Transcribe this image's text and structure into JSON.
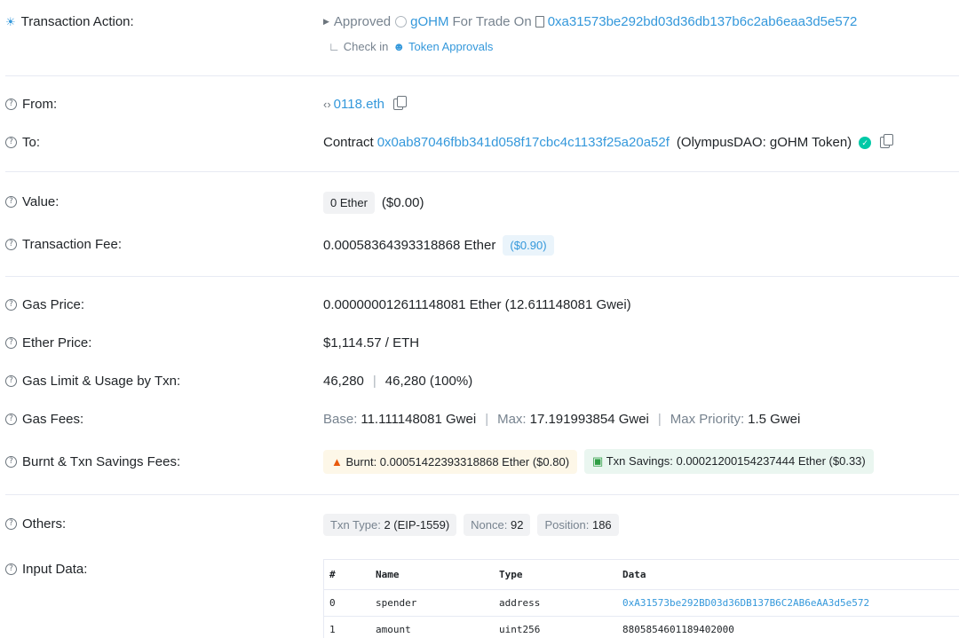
{
  "action": {
    "label": "Transaction Action:",
    "verb": "Approved",
    "token": "gOHM",
    "middle": "For Trade On",
    "address": "0xa31573be292bd03d36db137b6c2ab6eaa3d5e572",
    "check_prefix": "Check in",
    "check_link": "Token Approvals"
  },
  "from": {
    "label": "From:",
    "value": "0118.eth"
  },
  "to": {
    "label": "To:",
    "prefix": "Contract",
    "address": "0x0ab87046fbb341d058f17cbc4c1133f25a20a52f",
    "name": "(OlympusDAO: gOHM Token)"
  },
  "value": {
    "label": "Value:",
    "chip": "0 Ether",
    "usd": "($0.00)"
  },
  "fee": {
    "label": "Transaction Fee:",
    "value": "0.00058364393318868 Ether",
    "usd": "($0.90)"
  },
  "gas_price": {
    "label": "Gas Price:",
    "value": "0.000000012611148081 Ether (12.611148081 Gwei)"
  },
  "ether_price": {
    "label": "Ether Price:",
    "value": "$1,114.57 / ETH"
  },
  "gas_limit": {
    "label": "Gas Limit & Usage by Txn:",
    "limit": "46,280",
    "usage": "46,280 (100%)"
  },
  "gas_fees": {
    "label": "Gas Fees:",
    "base_k": "Base:",
    "base_v": "11.111148081 Gwei",
    "max_k": "Max:",
    "max_v": "17.191993854 Gwei",
    "prio_k": "Max Priority:",
    "prio_v": "1.5 Gwei"
  },
  "burnt": {
    "label": "Burnt & Txn Savings Fees:",
    "burnt": "Burnt: 0.00051422393318868 Ether ($0.80)",
    "savings": "Txn Savings: 0.00021200154237444 Ether ($0.33)"
  },
  "others": {
    "label": "Others:",
    "type_k": "Txn Type:",
    "type_v": "2 (EIP-1559)",
    "nonce_k": "Nonce:",
    "nonce_v": "92",
    "pos_k": "Position:",
    "pos_v": "186"
  },
  "input": {
    "label": "Input Data:",
    "headers": [
      "#",
      "Name",
      "Type",
      "Data"
    ],
    "rows": [
      [
        "0",
        "spender",
        "address",
        "0xA31573be292BD03d36DB137B6C2AB6eAA3d5e572"
      ],
      [
        "1",
        "amount",
        "uint256",
        "8805854601189402000"
      ]
    ]
  },
  "colors": {
    "link": "#3498db",
    "verified": "#00c9a7"
  }
}
